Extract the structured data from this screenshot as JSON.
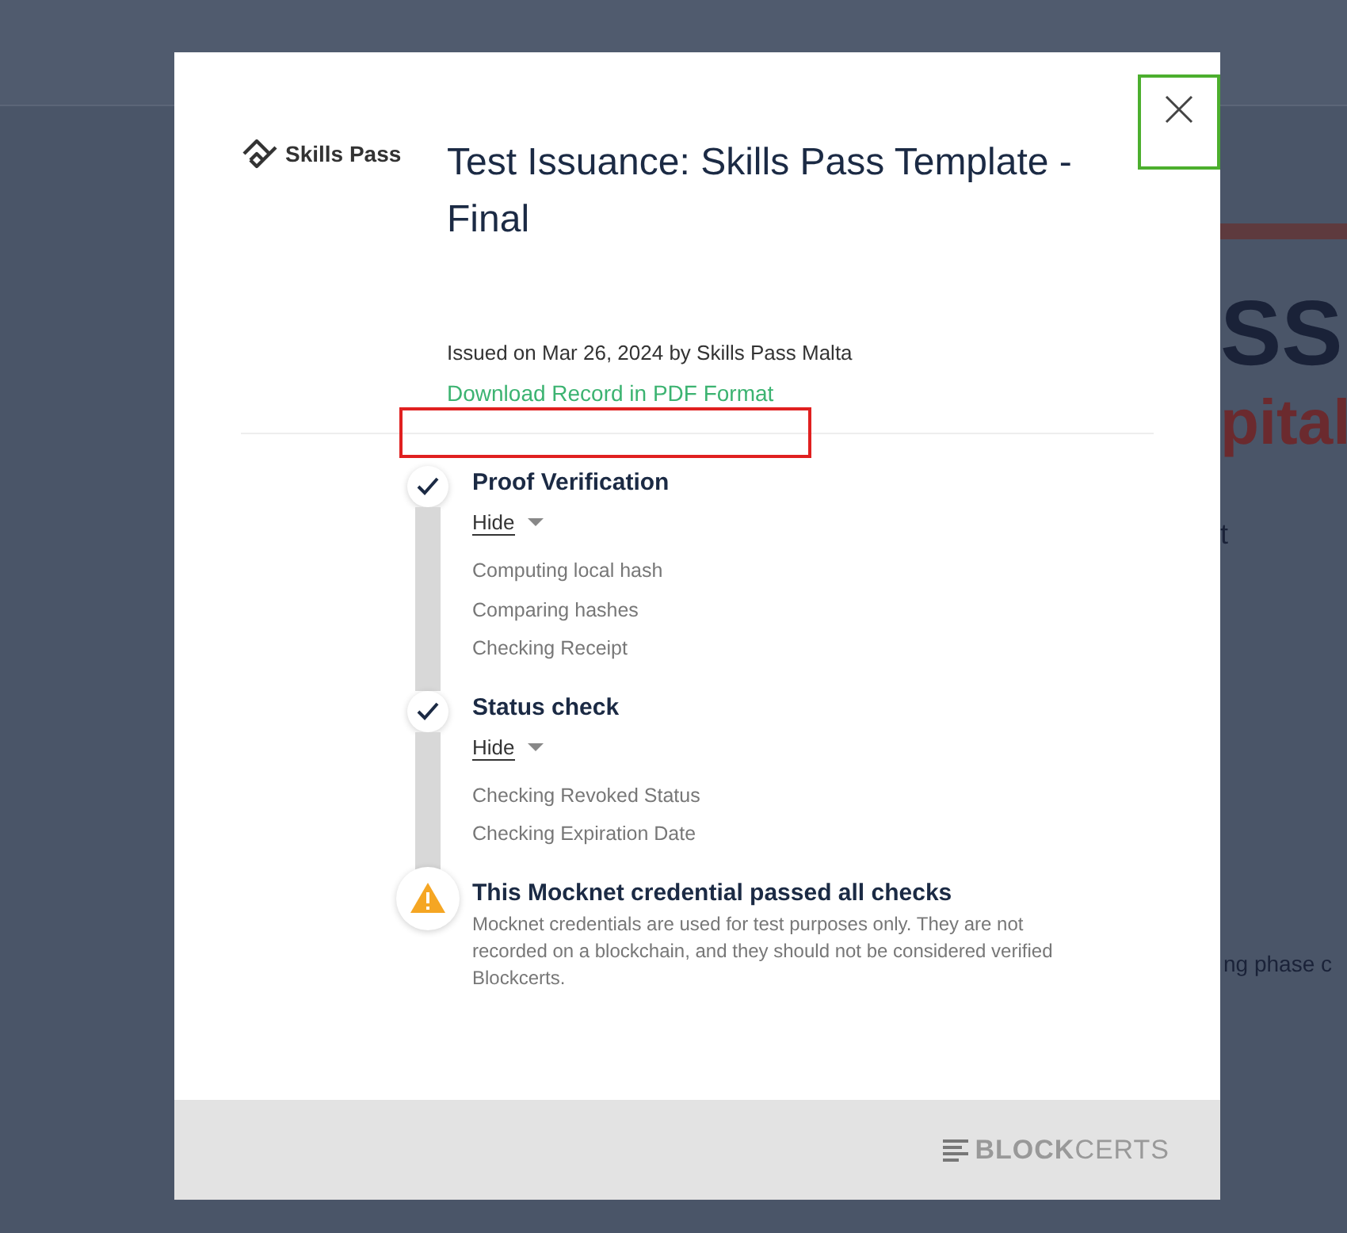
{
  "background_page": {
    "fragments": [
      {
        "text": "SS",
        "kind": "headline"
      },
      {
        "text": "pital",
        "kind": "subhead"
      },
      {
        "text": "t",
        "kind": "body"
      },
      {
        "text": "ng phase c",
        "kind": "body"
      }
    ]
  },
  "modal": {
    "logo": "Skills Pass",
    "title": "Test Issuance: Skills Pass Template - Final",
    "issued": "Issued on Mar 26, 2024 by Skills Pass Malta",
    "download_link": "Download Record in PDF Format",
    "steps": [
      {
        "kind": "check",
        "title": "Proof Verification",
        "toggle": "Hide",
        "expanded": true,
        "substeps": [
          "Computing local hash",
          "Comparing hashes",
          "Checking Receipt"
        ]
      },
      {
        "kind": "check",
        "title": "Status check",
        "toggle": "Hide",
        "expanded": true,
        "substeps": [
          "Checking Revoked Status",
          "Checking Expiration Date"
        ]
      },
      {
        "kind": "warning",
        "title": "This Mocknet credential passed all checks",
        "description": "Mocknet credentials are used for test purposes only. They are not recorded on a blockchain, and they should not be considered verified Blockcerts."
      }
    ],
    "footer": {
      "brand": "**BLOCK**CERTS"
    }
  }
}
